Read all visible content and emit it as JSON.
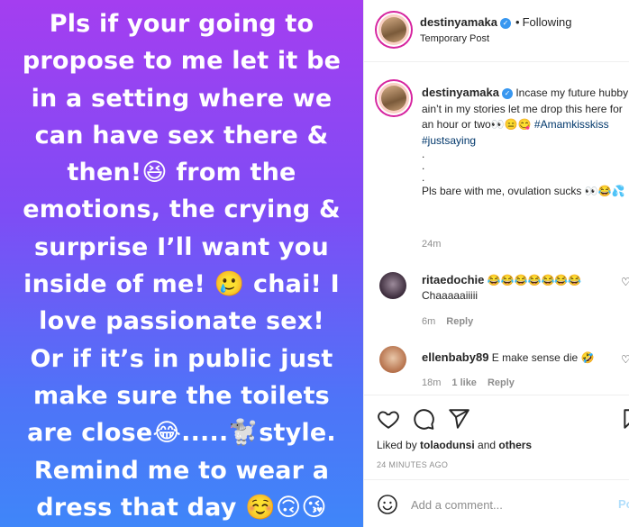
{
  "story": {
    "lines": [
      "Pls if your going to",
      "propose to me let it be",
      "in a setting where we",
      "can have sex there &",
      "then!😆 from the",
      "emotions, the crying  &",
      "surprise I’ll want you",
      "inside of me! 🥲 chai! I",
      "love passionate sex!",
      "Or if it’s in public just",
      "make sure the toilets",
      "are close😂.....🐩style.",
      "Remind me to wear a",
      "dress that day ☺️🙃😘"
    ]
  },
  "header": {
    "username": "destinyamaka",
    "verified_mark": "✓",
    "dot": "•",
    "follow_status": "Following",
    "subtitle": "Temporary Post"
  },
  "caption": {
    "username": "destinyamaka",
    "text": "Incase my future hubby ain’t in my stories let me drop this here for an hour or two👀😑😋",
    "tags": "#Amamkisskiss #justsaying",
    "dots": [
      ".",
      ".",
      "."
    ],
    "text2": "Pls bare with me, ovulation sucks 👀😂💦",
    "time": "24m"
  },
  "comments": [
    {
      "username": "ritaedochie",
      "text": "😂😂😂😂😂😂😂",
      "text2": "Chaaaaaiiiii",
      "time": "6m",
      "reply": "Reply"
    },
    {
      "username": "ellenbaby89",
      "text": "E make sense die 🤣",
      "time": "18m",
      "likes": "1 like",
      "reply": "Reply"
    }
  ],
  "actions": {
    "liked_by_prefix": "Liked by ",
    "liked_by_user": "tolaodunsi",
    "liked_by_mid": " and ",
    "liked_by_others": "others",
    "time_ago": "24 MINUTES AGO"
  },
  "add_comment": {
    "placeholder": "Add a comment...",
    "post_label": "Post"
  },
  "icons": [
    "heart-icon",
    "comment-icon",
    "share-icon",
    "bookmark-icon",
    "emoji-icon",
    "heart-small-icon"
  ],
  "colors": {
    "link": "#00376b",
    "verified": "#3897f0",
    "muted": "#8e8e8e",
    "post_button": "#b2dffc"
  }
}
